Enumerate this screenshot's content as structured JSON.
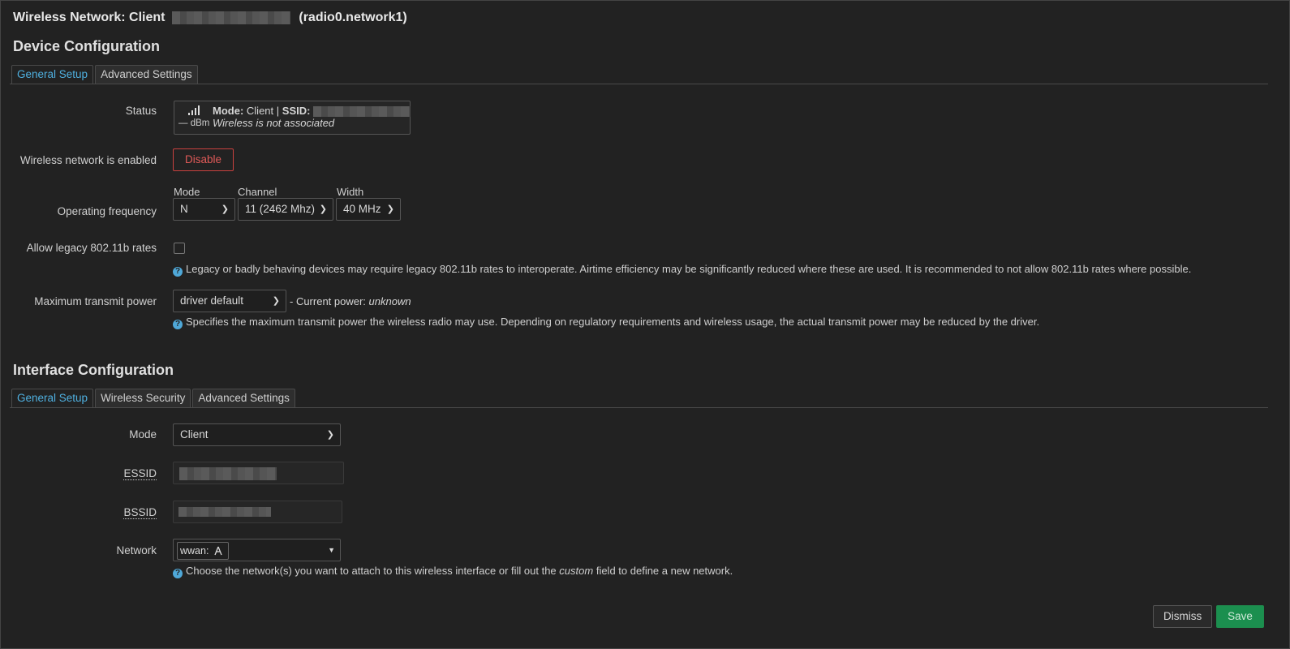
{
  "header": {
    "title_prefix": "Wireless Network: Client",
    "title_suffix": "(radio0.network1)"
  },
  "device_config": {
    "heading": "Device Configuration",
    "tabs": [
      {
        "label": "General Setup",
        "active": true
      },
      {
        "label": "Advanced Settings",
        "active": false
      }
    ],
    "status": {
      "label": "Status",
      "mode_label": "Mode:",
      "mode_value": "Client",
      "separator": "|",
      "ssid_label": "SSID:",
      "signal": "— dBm",
      "assoc_text": "Wireless is not associated"
    },
    "enabled": {
      "label": "Wireless network is enabled",
      "button": "Disable"
    },
    "frequency": {
      "label": "Operating frequency",
      "mode_label": "Mode",
      "mode_value": "N",
      "channel_label": "Channel",
      "channel_value": "11 (2462 Mhz)",
      "width_label": "Width",
      "width_value": "40 MHz"
    },
    "legacy": {
      "label": "Allow legacy 802.11b rates",
      "help": "Legacy or badly behaving devices may require legacy 802.11b rates to interoperate. Airtime efficiency may be significantly reduced where these are used. It is recommended to not allow 802.11b rates where possible."
    },
    "txpower": {
      "label": "Maximum transmit power",
      "value": "driver default",
      "current_prefix": "- Current power:",
      "current_value": "unknown",
      "help": "Specifies the maximum transmit power the wireless radio may use. Depending on regulatory requirements and wireless usage, the actual transmit power may be reduced by the driver."
    }
  },
  "interface_config": {
    "heading": "Interface Configuration",
    "tabs": [
      {
        "label": "General Setup",
        "active": true
      },
      {
        "label": "Wireless Security",
        "active": false
      },
      {
        "label": "Advanced Settings",
        "active": false
      }
    ],
    "mode": {
      "label": "Mode",
      "value": "Client"
    },
    "essid": {
      "label": "ESSID"
    },
    "bssid": {
      "label": "BSSID"
    },
    "network": {
      "label": "Network",
      "chip": "wwan:",
      "help_prefix": "Choose the network(s) you want to attach to this wireless interface or fill out the",
      "help_em": "custom",
      "help_suffix": "field to define a new network."
    }
  },
  "footer": {
    "dismiss": "Dismiss",
    "save": "Save"
  },
  "colors": {
    "accent": "#4fb0e0",
    "danger": "#e05a58",
    "save": "#1b8f4f",
    "background": "#222222"
  },
  "icons": [
    "signal-icon",
    "help-icon",
    "chevron-down-icon",
    "network-icon",
    "dropdown-caret-icon"
  ]
}
